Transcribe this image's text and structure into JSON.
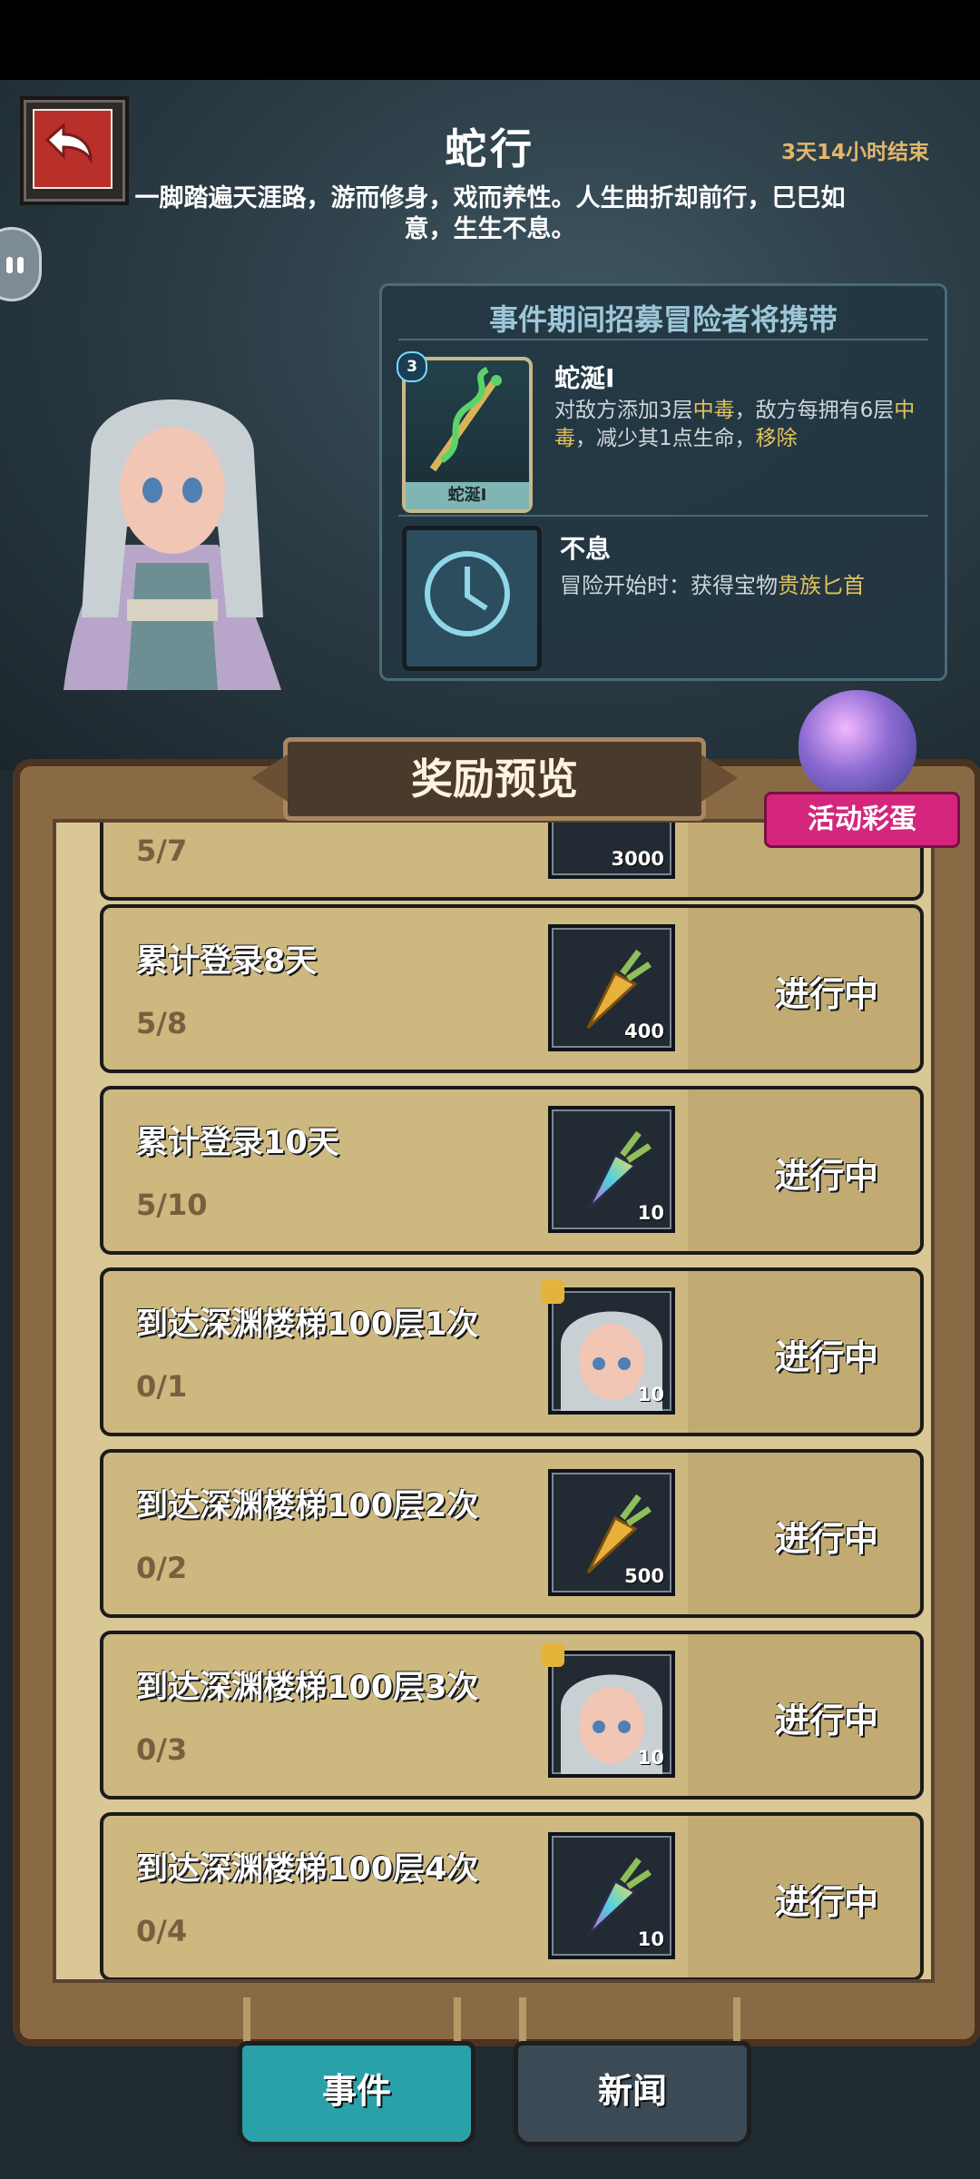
{
  "header": {
    "title": "蛇行",
    "timer": "3天14小时结束",
    "subtitle": "一脚踏遍天涯路，游而修身，戏而养性。人生曲折却前行，巳巳如意，生生不息。"
  },
  "buff_panel": {
    "heading": "事件期间招募冒险者将携带",
    "skill": {
      "level": "3",
      "icon_caption": "蛇涎I",
      "name": "蛇涎I",
      "desc_parts": [
        "对敌方添加3层",
        "中毒",
        "，敌方每拥有6层",
        "中毒",
        "，减少其1点生命，",
        "移除"
      ]
    },
    "relic": {
      "name": "不息",
      "desc_prefix": "冒险开始时：获得宝物",
      "desc_highlight": "贵族匕首"
    }
  },
  "rewards_title": "奖励预览",
  "egg_badge": "活动彩蛋",
  "rows": [
    {
      "title": "",
      "progress": "5/7",
      "qty": "3000",
      "icon": "carrot-icon",
      "status": ""
    },
    {
      "title": "累计登录8天",
      "progress": "5/8",
      "qty": "400",
      "icon": "golden-carrot-icon",
      "status": "进行中"
    },
    {
      "title": "累计登录10天",
      "progress": "5/10",
      "qty": "10",
      "icon": "rainbow-carrot-icon",
      "status": "进行中"
    },
    {
      "title": "到达深渊楼梯100层1次",
      "progress": "0/1",
      "qty": "10",
      "icon": "hero-portrait-icon",
      "status": "进行中"
    },
    {
      "title": "到达深渊楼梯100层2次",
      "progress": "0/2",
      "qty": "500",
      "icon": "golden-carrot-icon",
      "status": "进行中"
    },
    {
      "title": "到达深渊楼梯100层3次",
      "progress": "0/3",
      "qty": "10",
      "icon": "hero-portrait-icon",
      "status": "进行中"
    },
    {
      "title": "到达深渊楼梯100层4次",
      "progress": "0/4",
      "qty": "10",
      "icon": "rainbow-carrot-icon",
      "status": "进行中"
    }
  ],
  "tabs": {
    "event": "事件",
    "news": "新闻"
  }
}
